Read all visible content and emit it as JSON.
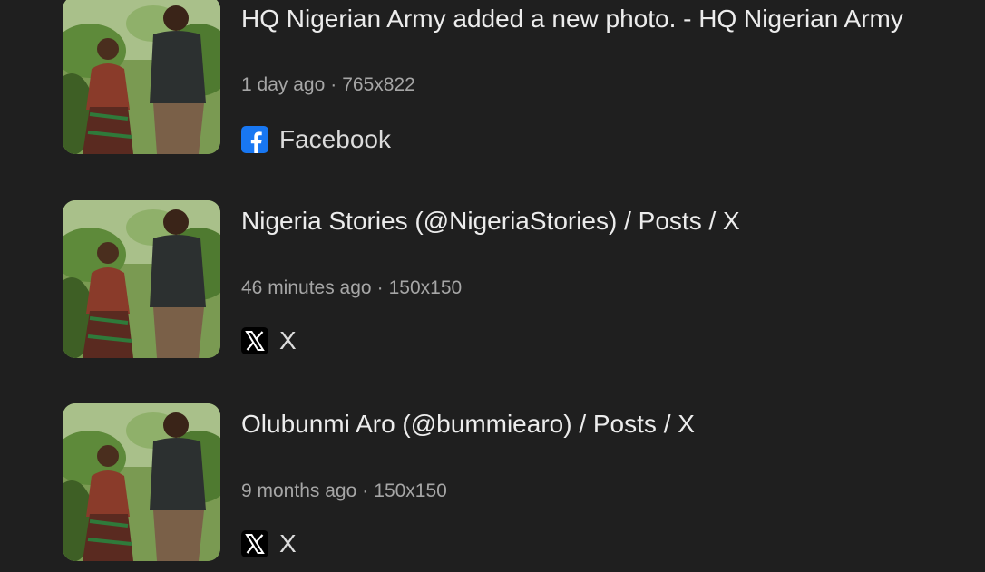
{
  "results": [
    {
      "title": "HQ Nigerian Army added a new photo. - HQ Nigerian Army",
      "time": "1 day ago",
      "separator": "·",
      "size": "765x822",
      "source_name": "Facebook",
      "source_icon": "facebook-icon"
    },
    {
      "title": "Nigeria Stories (@NigeriaStories) / Posts / X",
      "time": "46 minutes ago",
      "separator": "·",
      "size": "150x150",
      "source_name": "X",
      "source_icon": "x-icon"
    },
    {
      "title": "Olubunmi Aro (@bummiearo) / Posts / X",
      "time": "9 months ago",
      "separator": "·",
      "size": "150x150",
      "source_name": "X",
      "source_icon": "x-icon"
    }
  ],
  "colors": {
    "background": "#1f1f1f",
    "title_text": "#ececec",
    "meta_text": "#a6a6a6",
    "facebook_blue": "#1877f2",
    "x_black": "#000000"
  }
}
